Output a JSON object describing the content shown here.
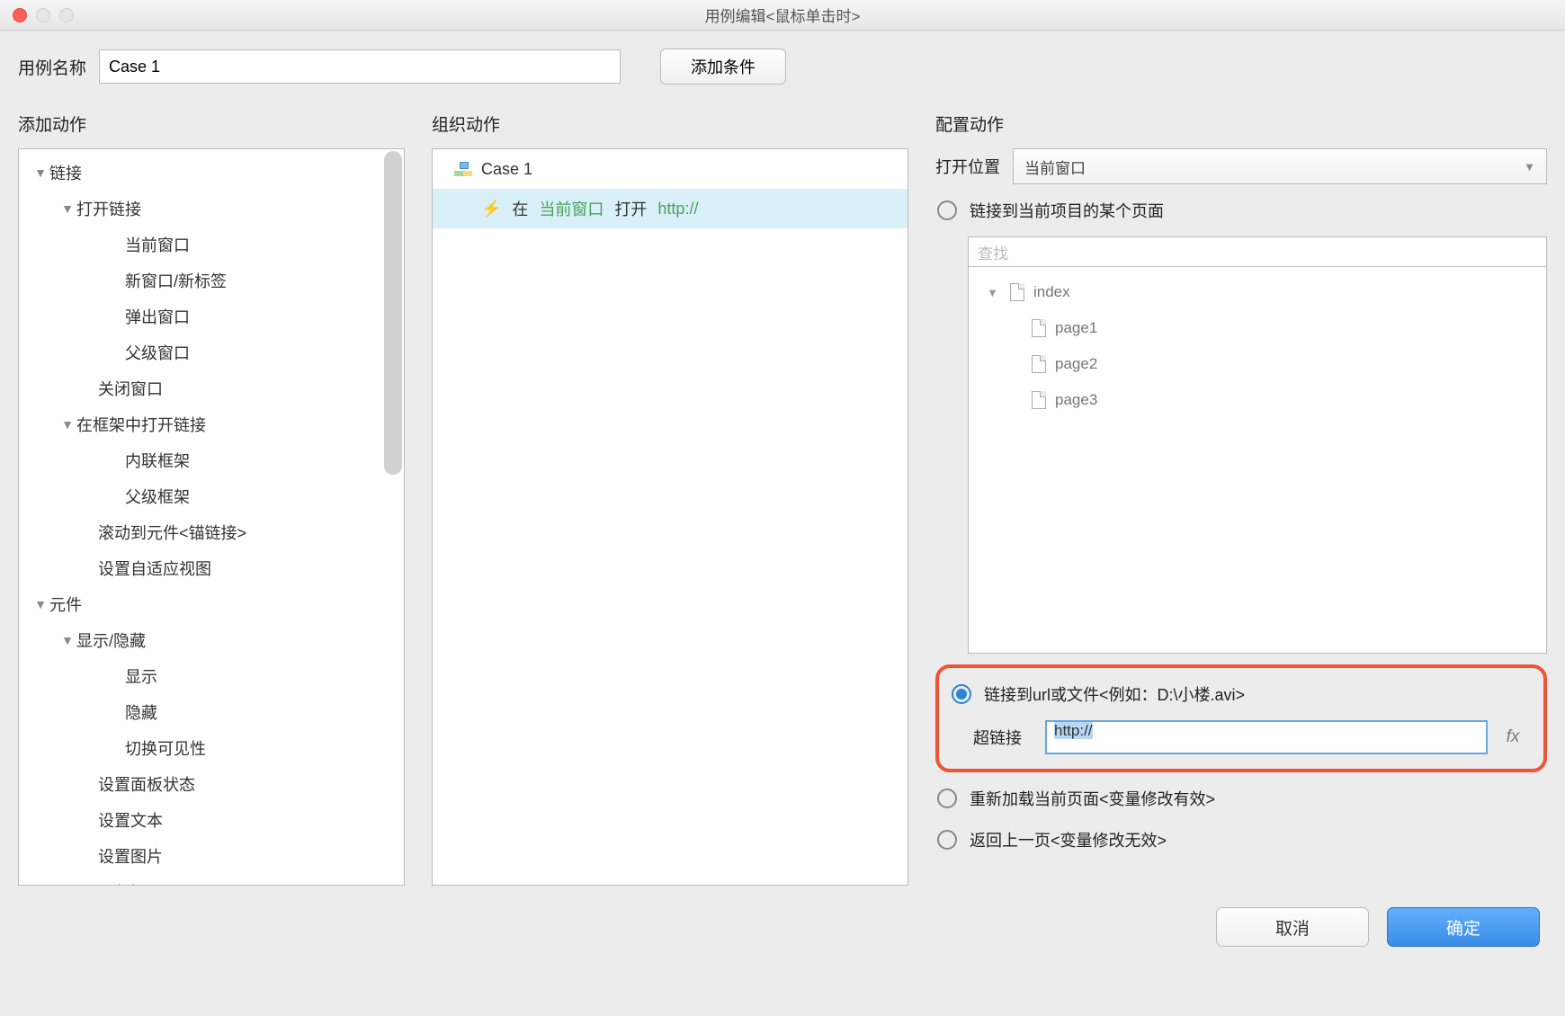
{
  "window": {
    "title": "用例编辑<鼠标单击时>"
  },
  "caseName": {
    "label": "用例名称",
    "value": "Case 1"
  },
  "addCondition": "添加条件",
  "headers": {
    "addAction": "添加动作",
    "organize": "组织动作",
    "configure": "配置动作"
  },
  "actionTree": {
    "g1": "链接",
    "g1_1": "打开链接",
    "g1_1_1": "当前窗口",
    "g1_1_2": "新窗口/新标签",
    "g1_1_3": "弹出窗口",
    "g1_1_4": "父级窗口",
    "g1_2": "关闭窗口",
    "g1_3": "在框架中打开链接",
    "g1_3_1": "内联框架",
    "g1_3_2": "父级框架",
    "g1_4": "滚动到元件<锚链接>",
    "g1_5": "设置自适应视图",
    "g2": "元件",
    "g2_1": "显示/隐藏",
    "g2_1_1": "显示",
    "g2_1_2": "隐藏",
    "g2_1_3": "切换可见性",
    "g2_2": "设置面板状态",
    "g2_3": "设置文本",
    "g2_4": "设置图片",
    "g2_5": "设置选中"
  },
  "organize": {
    "caseLabel": "Case 1",
    "actionPrefix": "在",
    "actionWindow": "当前窗口",
    "actionVerb": "打开",
    "actionUrl": "http://"
  },
  "config": {
    "openInLabel": "打开位置",
    "openInValue": "当前窗口",
    "opt1": "链接到当前项目的某个页面",
    "searchPlaceholder": "查找",
    "pages": {
      "root": "index",
      "p1": "page1",
      "p2": "page2",
      "p3": "page3"
    },
    "opt2": "链接到url或文件<例如：D:\\小楼.avi>",
    "hyperlinkLabel": "超链接",
    "hyperlinkValue": "http://",
    "fxLabel": "fx",
    "opt3": "重新加载当前页面<变量修改有效>",
    "opt4": "返回上一页<变量修改无效>"
  },
  "footer": {
    "cancel": "取消",
    "ok": "确定"
  }
}
